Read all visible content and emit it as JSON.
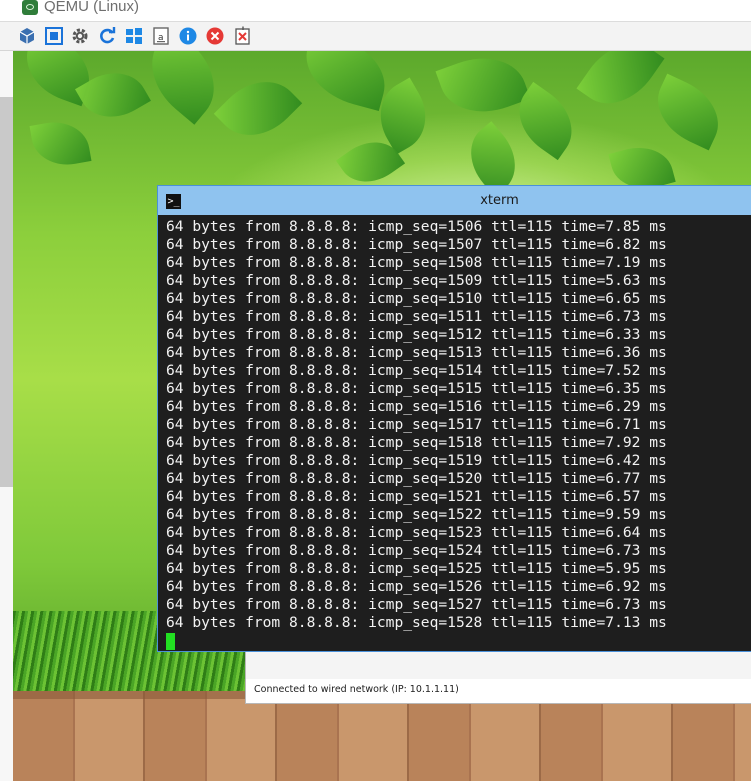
{
  "host_window": {
    "title": "QEMU (Linux)"
  },
  "toolbar": {
    "buttons": [
      {
        "name": "vm-settings-icon"
      },
      {
        "name": "fullscreen-icon"
      },
      {
        "name": "gear-icon"
      },
      {
        "name": "refresh-icon"
      },
      {
        "name": "windows-icon"
      },
      {
        "name": "keyboard-icon"
      },
      {
        "name": "info-icon"
      },
      {
        "name": "close-icon"
      },
      {
        "name": "exit-icon"
      }
    ],
    "colors": {
      "accent_blue": "#1a73d9",
      "close_red": "#e53935",
      "info_blue": "#1e88e5"
    }
  },
  "xterm": {
    "title": "xterm",
    "icon_glyph": ">_",
    "lines": [
      "64 bytes from 8.8.8.8: icmp_seq=1506 ttl=115 time=7.85 ms",
      "64 bytes from 8.8.8.8: icmp_seq=1507 ttl=115 time=6.82 ms",
      "64 bytes from 8.8.8.8: icmp_seq=1508 ttl=115 time=7.19 ms",
      "64 bytes from 8.8.8.8: icmp_seq=1509 ttl=115 time=5.63 ms",
      "64 bytes from 8.8.8.8: icmp_seq=1510 ttl=115 time=6.65 ms",
      "64 bytes from 8.8.8.8: icmp_seq=1511 ttl=115 time=6.73 ms",
      "64 bytes from 8.8.8.8: icmp_seq=1512 ttl=115 time=6.33 ms",
      "64 bytes from 8.8.8.8: icmp_seq=1513 ttl=115 time=6.36 ms",
      "64 bytes from 8.8.8.8: icmp_seq=1514 ttl=115 time=7.52 ms",
      "64 bytes from 8.8.8.8: icmp_seq=1515 ttl=115 time=6.35 ms",
      "64 bytes from 8.8.8.8: icmp_seq=1516 ttl=115 time=6.29 ms",
      "64 bytes from 8.8.8.8: icmp_seq=1517 ttl=115 time=6.71 ms",
      "64 bytes from 8.8.8.8: icmp_seq=1518 ttl=115 time=7.92 ms",
      "64 bytes from 8.8.8.8: icmp_seq=1519 ttl=115 time=6.42 ms",
      "64 bytes from 8.8.8.8: icmp_seq=1520 ttl=115 time=6.77 ms",
      "64 bytes from 8.8.8.8: icmp_seq=1521 ttl=115 time=6.57 ms",
      "64 bytes from 8.8.8.8: icmp_seq=1522 ttl=115 time=9.59 ms",
      "64 bytes from 8.8.8.8: icmp_seq=1523 ttl=115 time=6.64 ms",
      "64 bytes from 8.8.8.8: icmp_seq=1524 ttl=115 time=6.73 ms",
      "64 bytes from 8.8.8.8: icmp_seq=1525 ttl=115 time=5.95 ms",
      "64 bytes from 8.8.8.8: icmp_seq=1526 ttl=115 time=6.92 ms",
      "64 bytes from 8.8.8.8: icmp_seq=1527 ttl=115 time=6.73 ms",
      "64 bytes from 8.8.8.8: icmp_seq=1528 ttl=115 time=7.13 ms"
    ],
    "colors": {
      "background": "#1e1e1e",
      "foreground": "#f2f2f2",
      "cursor": "#22e022",
      "titlebar": "#8fc3ef"
    }
  },
  "network_dialog": {
    "status": "Connected to wired network (IP: 10.1.1.11)"
  }
}
